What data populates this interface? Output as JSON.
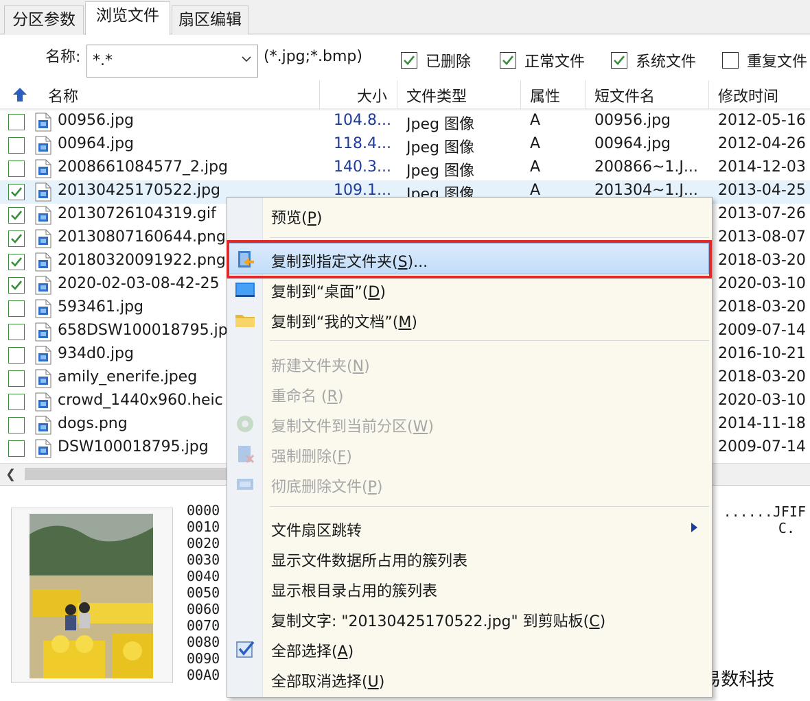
{
  "tabs": [
    "分区参数",
    "浏览文件",
    "扇区编辑"
  ],
  "active_tab": 1,
  "filter": {
    "label": "名称:",
    "pattern": "*.*",
    "ext_hint": "(*.jpg;*.bmp)",
    "checks": [
      {
        "label": "已删除",
        "checked": true
      },
      {
        "label": "正常文件",
        "checked": true
      },
      {
        "label": "系统文件",
        "checked": true
      },
      {
        "label": "重复文件",
        "checked": false
      }
    ]
  },
  "columns": [
    "名称",
    "大小",
    "文件类型",
    "属性",
    "短文件名",
    "修改时间"
  ],
  "files": [
    {
      "name": "00956.jpg",
      "size": "104.8...",
      "type": "Jpeg 图像",
      "attr": "A",
      "short": "00956.jpg",
      "mtime": "2012-05-16",
      "checked": false
    },
    {
      "name": "00964.jpg",
      "size": "118.4...",
      "type": "Jpeg 图像",
      "attr": "A",
      "short": "00964.jpg",
      "mtime": "2012-04-26",
      "checked": false
    },
    {
      "name": "2008661084577_2.jpg",
      "size": "140.3...",
      "type": "Jpeg 图像",
      "attr": "A",
      "short": "200866~1.J...",
      "mtime": "2014-12-03",
      "checked": false
    },
    {
      "name": "20130425170522.jpg",
      "size": "109.1...",
      "type": "Jpeg 图像",
      "attr": "A",
      "short": "201304~1.J...",
      "mtime": "2013-04-25",
      "checked": true
    },
    {
      "name": "20130726104319.gif",
      "size": "",
      "type": "",
      "attr": "",
      "short": "",
      "mtime": "2013-07-26",
      "checked": true
    },
    {
      "name": "20130807160644.png",
      "size": "",
      "type": "",
      "attr": "",
      "short": "",
      "mtime": "2013-08-07",
      "checked": true
    },
    {
      "name": "20180320091922.png",
      "size": "",
      "type": "",
      "attr": "",
      "short": "",
      "mtime": "2018-03-20",
      "checked": true
    },
    {
      "name": "2020-02-03-08-42-25",
      "size": "",
      "type": "",
      "attr": "",
      "short": "",
      "mtime": "2020-03-10",
      "checked": true
    },
    {
      "name": "593461.jpg",
      "size": "",
      "type": "",
      "attr": "",
      "short": "",
      "mtime": "2018-03-20",
      "checked": false
    },
    {
      "name": "658DSW100018795.jp",
      "size": "",
      "type": "",
      "attr": "",
      "short": "",
      "mtime": "2009-07-14",
      "checked": false
    },
    {
      "name": "934d0.jpg",
      "size": "",
      "type": "",
      "attr": "",
      "short": "",
      "mtime": "2016-10-21",
      "checked": false
    },
    {
      "name": "amily_enerife.jpeg",
      "size": "",
      "type": "",
      "attr": "",
      "short": "",
      "mtime": "2018-03-20",
      "checked": false
    },
    {
      "name": "crowd_1440x960.heic",
      "size": "",
      "type": "",
      "attr": "",
      "short": "",
      "mtime": "2020-03-10",
      "checked": false
    },
    {
      "name": "dogs.png",
      "size": "",
      "type": "",
      "attr": "",
      "short": "",
      "mtime": "2014-11-18",
      "checked": false
    },
    {
      "name": "DSW100018795.jpg",
      "size": "",
      "type": "",
      "attr": "",
      "short": "",
      "mtime": "2009-07-14",
      "checked": false
    }
  ],
  "hex": {
    "offsets": [
      "0000",
      "0010",
      "0020",
      "0030",
      "0040",
      "0050",
      "0060",
      "0070",
      "0080",
      "0090",
      "00A0"
    ],
    "ascii": [
      "......JFIF",
      "C."
    ]
  },
  "context_menu": {
    "items": [
      {
        "label": "预览",
        "key": "P",
        "icon": "",
        "disabled": false,
        "highlighted": false
      },
      {
        "label": "复制到指定文件夹",
        "key": "S",
        "suffix": "...",
        "icon": "copy-to-folder-icon",
        "disabled": false,
        "highlighted": true
      },
      {
        "label": "复制到“桌面”",
        "key": "D",
        "icon": "desktop-icon",
        "disabled": false,
        "highlighted": false
      },
      {
        "label": "复制到“我的文档”",
        "key": "M",
        "icon": "folder-icon",
        "disabled": false,
        "highlighted": false
      },
      {
        "label": "新建文件夹",
        "key": "N",
        "icon": "",
        "disabled": true,
        "highlighted": false
      },
      {
        "label": "重命名 ",
        "key": "R",
        "icon": "",
        "disabled": true,
        "highlighted": false
      },
      {
        "label": "复制文件到当前分区",
        "key": "W",
        "icon": "copy-partition-icon",
        "disabled": true,
        "highlighted": false
      },
      {
        "label": "强制删除",
        "key": "F",
        "icon": "force-delete-icon",
        "disabled": true,
        "highlighted": false
      },
      {
        "label": "彻底删除文件",
        "key": "P",
        "icon": "wipe-icon",
        "disabled": true,
        "highlighted": false
      },
      {
        "label": "文件扇区跳转",
        "key": "",
        "icon": "",
        "disabled": false,
        "highlighted": false,
        "submenu": true
      },
      {
        "label": "显示文件数据所占用的簇列表",
        "key": "",
        "icon": "",
        "disabled": false,
        "highlighted": false
      },
      {
        "label": "显示根目录占用的簇列表",
        "key": "",
        "icon": "",
        "disabled": false,
        "highlighted": false
      },
      {
        "label": "复制文字: \"20130425170522.jpg\" 到剪贴板",
        "key": "C",
        "icon": "",
        "disabled": false,
        "highlighted": false
      },
      {
        "label": "全部选择",
        "key": "A",
        "icon": "check-all-icon",
        "disabled": false,
        "highlighted": false
      },
      {
        "label": "全部取消选择",
        "key": "U",
        "icon": "",
        "disabled": false,
        "highlighted": false
      }
    ]
  },
  "watermark": "头条 @易数科技",
  "colors": {
    "highlight_border": "#e0292b",
    "check_green": "#3a8c3a",
    "size_blue": "#1f3c9c"
  }
}
